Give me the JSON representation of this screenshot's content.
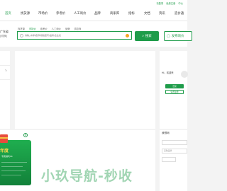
{
  "topbar": {
    "links": [
      "请登录",
      "免费注册",
      "中心"
    ]
  },
  "nav": {
    "items": [
      {
        "label": "首页",
        "active": true
      },
      {
        "label": "找货源",
        "active": false
      },
      {
        "label": "市场价",
        "active": false
      },
      {
        "label": "参考价",
        "active": false
      },
      {
        "label": "人工询价",
        "active": false
      },
      {
        "label": "品牌",
        "active": false
      },
      {
        "label": "商家库",
        "active": false
      },
      {
        "label": "指标",
        "active": false
      },
      {
        "label": "文档",
        "active": false
      },
      {
        "label": "资讯",
        "active": false
      },
      {
        "label": "造价通",
        "active": false
      }
    ]
  },
  "region": {
    "name": "广东省",
    "sub": "[切换]"
  },
  "search": {
    "tabs": [
      {
        "label": "找货源",
        "active": false
      },
      {
        "label": "市场价",
        "active": true
      },
      {
        "label": "参考价",
        "active": false
      },
      {
        "label": "人工询价",
        "active": false
      },
      {
        "label": "品牌",
        "active": false
      },
      {
        "label": "供应商",
        "active": false
      }
    ],
    "placeholder": "请输入材料名称/规格型号/品牌/企业名",
    "button_label": "搜索",
    "post_label": "发布询价"
  },
  "login": {
    "greeting": "Hi，欢迎来",
    "login_label": "登录",
    "register_label": "免费注册"
  },
  "promo": {
    "year_text": "年度",
    "slogan": "专属福利PK"
  },
  "watermark": "小玖导航-秒收",
  "side_form": {
    "title": "我想询",
    "field1": "",
    "field2": "采购品牌",
    "field3": ""
  }
}
